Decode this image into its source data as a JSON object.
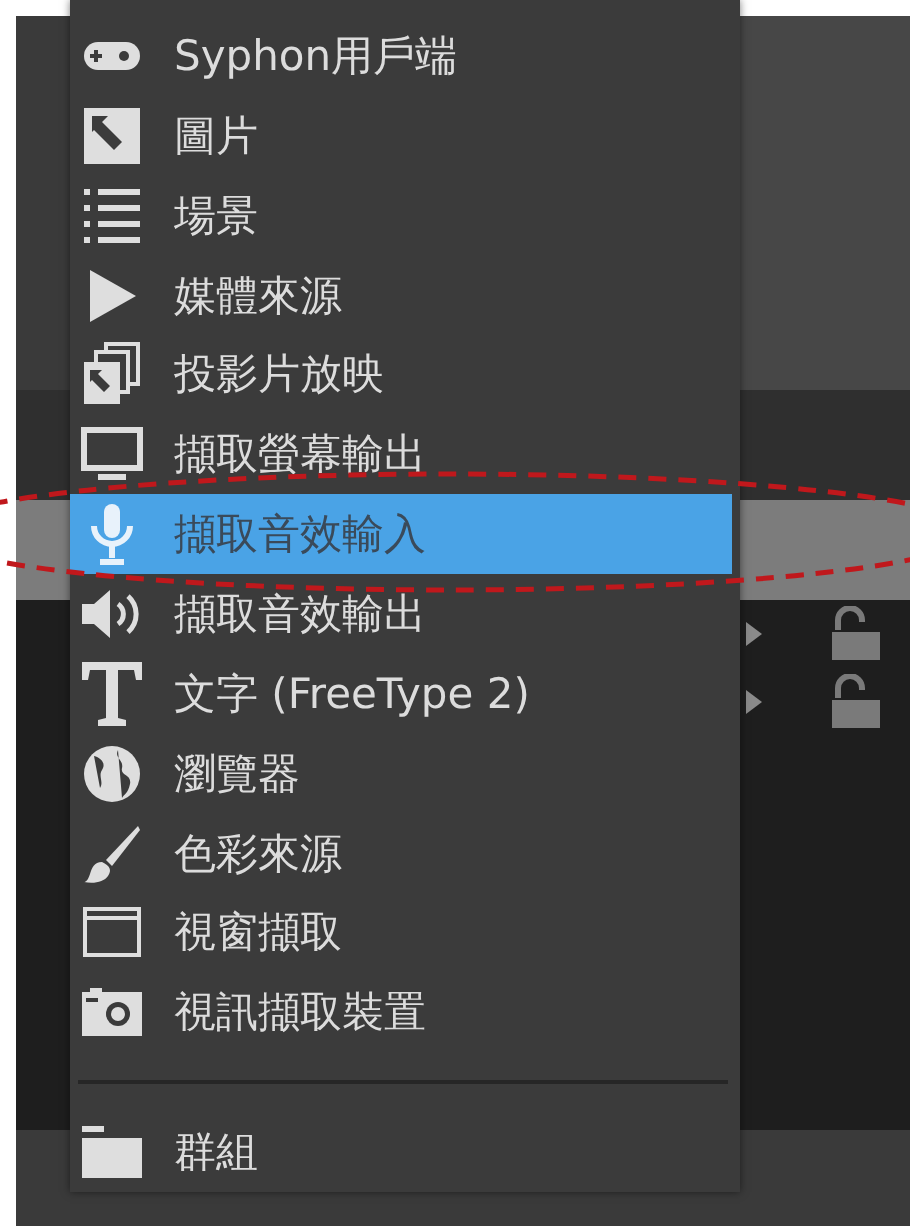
{
  "menu": {
    "items": [
      {
        "kind": "item",
        "label": "Syphon用戶端",
        "selected": false
      },
      {
        "kind": "item",
        "label": "圖片",
        "selected": false
      },
      {
        "kind": "item",
        "label": "場景",
        "selected": false
      },
      {
        "kind": "item",
        "label": "媒體來源",
        "selected": false
      },
      {
        "kind": "item",
        "label": "投影片放映",
        "selected": false
      },
      {
        "kind": "item",
        "label": "擷取螢幕輸出",
        "selected": false
      },
      {
        "kind": "item",
        "label": "擷取音效輸入",
        "selected": true
      },
      {
        "kind": "item",
        "label": "擷取音效輸出",
        "selected": false
      },
      {
        "kind": "item",
        "label": "文字 (FreeType 2)",
        "selected": false
      },
      {
        "kind": "item",
        "label": "瀏覽器",
        "selected": false
      },
      {
        "kind": "item",
        "label": "色彩來源",
        "selected": false
      },
      {
        "kind": "item",
        "label": "視窗擷取",
        "selected": false
      },
      {
        "kind": "item",
        "label": "視訊擷取裝置",
        "selected": false
      },
      {
        "kind": "separator"
      },
      {
        "kind": "item",
        "label": "群組",
        "selected": false
      }
    ]
  }
}
